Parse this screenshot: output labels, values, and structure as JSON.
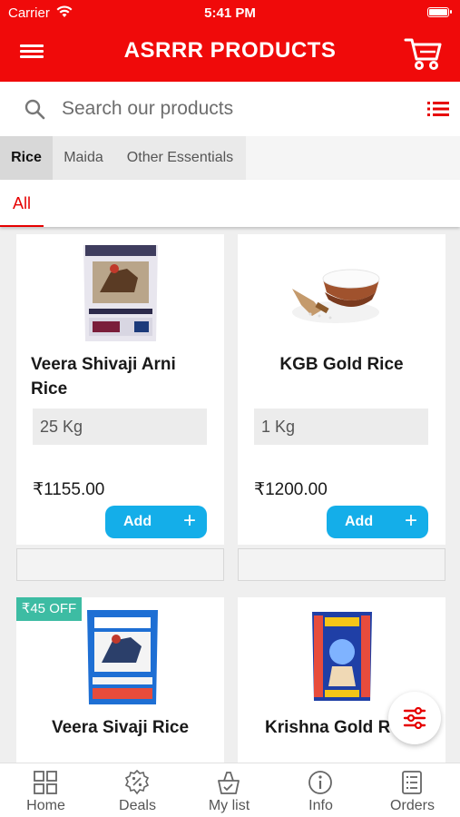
{
  "status_bar": {
    "carrier": "Carrier",
    "time": "5:41 PM"
  },
  "header": {
    "title": "ASRRR PRODUCTS",
    "menu_icon": "hamburger-icon",
    "cart_icon": "cart-icon"
  },
  "search": {
    "placeholder": "Search our products",
    "icon": "search-icon",
    "list_icon": "list-view-icon"
  },
  "category_tabs": [
    "Rice",
    "Maida",
    "Other Essentials"
  ],
  "active_category": "Rice",
  "sub_tabs": [
    "All"
  ],
  "products": [
    {
      "name": "Veera Shivaji Arni Rice",
      "variant": "25 Kg",
      "price": "₹1155.00",
      "add_label": "Add",
      "plus": "+"
    },
    {
      "name": "KGB Gold Rice",
      "variant": "1 Kg",
      "price": "₹1200.00",
      "add_label": "Add",
      "plus": "+"
    },
    {
      "name": "Veera Sivaji Rice",
      "badge": "₹45 OFF"
    },
    {
      "name": "Krishna Gold R"
    }
  ],
  "bottom_nav": [
    {
      "label": "Home",
      "icon": "grid-icon"
    },
    {
      "label": "Deals",
      "icon": "deals-badge-icon"
    },
    {
      "label": "My list",
      "icon": "basket-icon"
    },
    {
      "label": "Info",
      "icon": "info-icon"
    },
    {
      "label": "Orders",
      "icon": "orders-icon"
    }
  ],
  "colors": {
    "brand_red": "#f00a0a",
    "add_blue": "#14aee9",
    "badge_teal": "#3dbca3"
  }
}
